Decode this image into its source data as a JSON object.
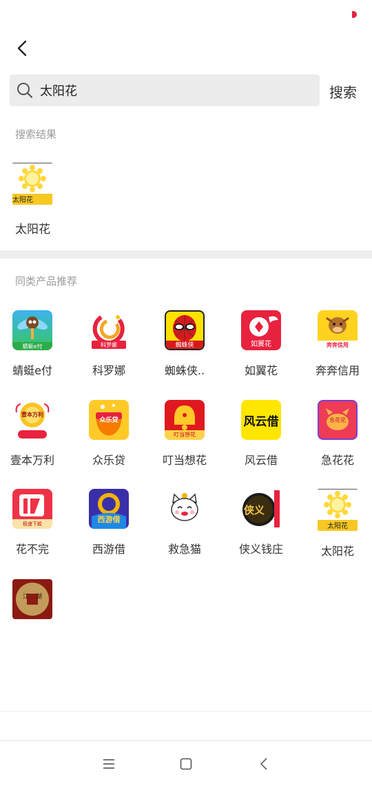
{
  "search": {
    "query": "太阳花",
    "button_label": "搜索"
  },
  "results": {
    "heading": "搜索结果",
    "items": [
      {
        "label": "太阳花",
        "icon": "sunflower-app-icon",
        "icon_text": "太阳花"
      }
    ]
  },
  "recommend": {
    "heading": "同类产品推荐",
    "items": [
      {
        "label": "蜻蜓e付",
        "icon": "dragonfly-app-icon",
        "icon_text": "蜻蜓e付"
      },
      {
        "label": "科罗娜",
        "icon": "keluona-app-icon",
        "icon_text": "科罗娜"
      },
      {
        "label": "蜘蛛侠..",
        "icon": "spiderman-app-icon",
        "icon_text": "蜘蛛侠"
      },
      {
        "label": "如翼花",
        "icon": "ruyihua-app-icon",
        "icon_text": "如翼花"
      },
      {
        "label": "奔奔信用",
        "icon": "benben-app-icon",
        "icon_text": "奔奔信用"
      },
      {
        "label": "壹本万利",
        "icon": "yiben-app-icon",
        "icon_text": "壹本万利"
      },
      {
        "label": "众乐贷",
        "icon": "zhongle-app-icon",
        "icon_text": "众乐贷"
      },
      {
        "label": "叮当想花",
        "icon": "dingdang-app-icon",
        "icon_text": "叮当想花"
      },
      {
        "label": "风云借",
        "icon": "fengyun-app-icon",
        "icon_text": "风云借"
      },
      {
        "label": "急花花",
        "icon": "jihuahua-app-icon",
        "icon_text": "急花花"
      },
      {
        "label": "花不完",
        "icon": "huabuwan-app-icon",
        "icon_text": "极速下款"
      },
      {
        "label": "西游借",
        "icon": "xiyou-app-icon",
        "icon_text": "西游借"
      },
      {
        "label": "救急猫",
        "icon": "lucky-cat-app-icon",
        "icon_text": ""
      },
      {
        "label": "侠义钱庄",
        "icon": "xiayi-app-icon",
        "icon_text": "侠义"
      },
      {
        "label": "太阳花",
        "icon": "sunflower-app-icon",
        "icon_text": "太阳花"
      },
      {
        "label": "",
        "icon": "jianghu-app-icon",
        "icon_text": "江湖"
      }
    ]
  },
  "colors": {
    "accent_red": "#e8223f",
    "divider": "#eeeeee",
    "search_bg": "#ececec"
  }
}
